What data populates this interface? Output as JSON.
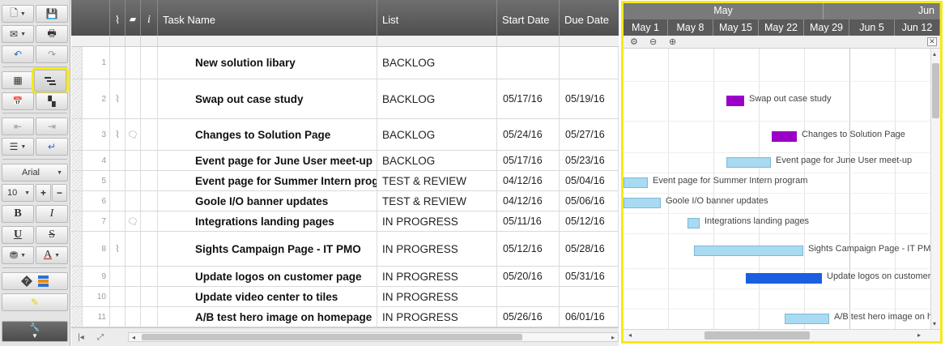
{
  "toolbar": {
    "font_name": "Arial",
    "font_size": "10",
    "bold_label": "B",
    "italic_label": "I",
    "underline_label": "U",
    "strike_label": "S",
    "font_color_label": "A"
  },
  "grid": {
    "columns": {
      "info": "i",
      "task_name": "Task Name",
      "list": "List",
      "start_date": "Start Date",
      "due_date": "Due Date"
    },
    "rows": [
      {
        "num": "1",
        "task": "New solution libary",
        "list": "BACKLOG",
        "start": "",
        "due": "",
        "attachment": false,
        "comment": false
      },
      {
        "num": "2",
        "task": "Swap out case study",
        "list": "BACKLOG",
        "start": "05/17/16",
        "due": "05/19/16",
        "attachment": true,
        "comment": false
      },
      {
        "num": "3",
        "task": "Changes to Solution Page",
        "list": "BACKLOG",
        "start": "05/24/16",
        "due": "05/27/16",
        "attachment": true,
        "comment": true
      },
      {
        "num": "4",
        "task": "Event page for June User meet-up",
        "list": "BACKLOG",
        "start": "05/17/16",
        "due": "05/23/16",
        "attachment": false,
        "comment": false
      },
      {
        "num": "5",
        "task": "Event page for Summer Intern prog",
        "list": "TEST & REVIEW",
        "start": "04/12/16",
        "due": "05/04/16",
        "attachment": false,
        "comment": false
      },
      {
        "num": "6",
        "task": "Goole I/O banner updates",
        "list": "TEST & REVIEW",
        "start": "04/12/16",
        "due": "05/06/16",
        "attachment": false,
        "comment": false
      },
      {
        "num": "7",
        "task": "Integrations landing pages",
        "list": "IN PROGRESS",
        "start": "05/11/16",
        "due": "05/12/16",
        "attachment": false,
        "comment": true
      },
      {
        "num": "8",
        "task": "Sights Campaign Page - IT PMO",
        "list": "IN PROGRESS",
        "start": "05/12/16",
        "due": "05/28/16",
        "attachment": true,
        "comment": false
      },
      {
        "num": "9",
        "task": "Update logos on customer page",
        "list": "IN PROGRESS",
        "start": "05/20/16",
        "due": "05/31/16",
        "attachment": false,
        "comment": false
      },
      {
        "num": "10",
        "task": "Update video center to tiles",
        "list": "IN PROGRESS",
        "start": "",
        "due": "",
        "attachment": false,
        "comment": false
      },
      {
        "num": "11",
        "task": "A/B test hero image on homepage",
        "list": "IN PROGRESS",
        "start": "05/26/16",
        "due": "06/01/16",
        "attachment": false,
        "comment": false
      }
    ]
  },
  "gantt": {
    "months": [
      "May",
      "Jun"
    ],
    "weeks": [
      "May 1",
      "May 8",
      "May 15",
      "May 22",
      "May 29",
      "Jun 5",
      "Jun 12"
    ],
    "bars": [
      {
        "row": 1,
        "label": "Swap out case study",
        "color": "#9a00c8"
      },
      {
        "row": 2,
        "label": "Changes to Solution Page",
        "color": "#9a00c8"
      },
      {
        "row": 3,
        "label": "Event page for June User meet-up",
        "color": "#a8daf2"
      },
      {
        "row": 4,
        "label": "Event page for Summer Intern program",
        "color": "#a8daf2"
      },
      {
        "row": 5,
        "label": "Goole I/O banner updates",
        "color": "#a8daf2"
      },
      {
        "row": 6,
        "label": "Integrations landing pages",
        "color": "#a8daf2"
      },
      {
        "row": 7,
        "label": "Sights Campaign Page - IT PMO",
        "color": "#a8daf2"
      },
      {
        "row": 8,
        "label": "Update logos on customer page",
        "color": "#1a5fe0"
      },
      {
        "row": 10,
        "label": "A/B test hero image on homepage",
        "color": "#a8daf2"
      }
    ]
  }
}
